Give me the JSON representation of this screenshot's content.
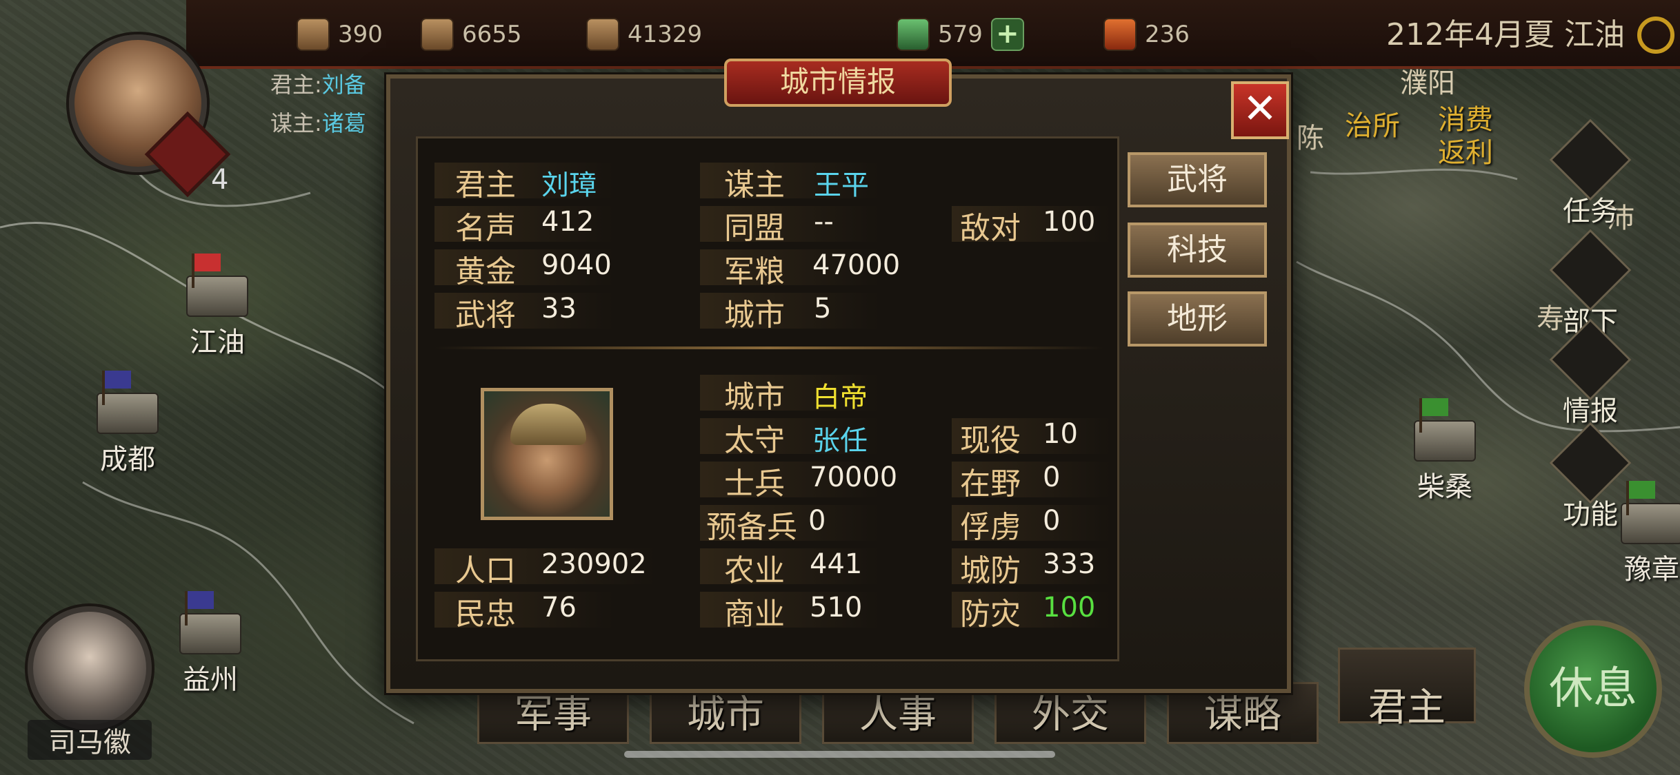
{
  "top_bar": {
    "resources": [
      {
        "icon": "ore-icon",
        "value": "390"
      },
      {
        "icon": "coin-pouch-icon",
        "value": "6655"
      },
      {
        "icon": "grain-icon",
        "value": "41329"
      },
      {
        "icon": "jade-icon",
        "value": "579"
      },
      {
        "icon": "scroll-icon",
        "value": "236"
      }
    ],
    "datetime_location": "212年4月夏 江油"
  },
  "ruler_info": {
    "ruler_label": "君主:",
    "ruler_value": "刘备",
    "advisor_label": "谋主:",
    "advisor_value": "诸葛",
    "seal_count": "4"
  },
  "advisor_name": "司马徽",
  "map_cities": [
    {
      "name": "江油",
      "flag_color": "#c83030"
    },
    {
      "name": "成都",
      "flag_color": "#3a3a90"
    },
    {
      "name": "益州",
      "flag_color": "#3a3a90"
    },
    {
      "name": "柴桑",
      "flag_color": "#3a9030"
    },
    {
      "name": "豫章",
      "flag_color": "#3a9030"
    }
  ],
  "map_glyphs": [
    "濮阳",
    "陈",
    "沛",
    "寿"
  ],
  "right_menu": {
    "events": [
      {
        "label": "治所"
      },
      {
        "label": "消费返利"
      }
    ],
    "items": [
      {
        "label": "任务"
      },
      {
        "label": "部下"
      },
      {
        "label": "情报"
      },
      {
        "label": "功能"
      }
    ]
  },
  "bottom_menu": [
    "军事",
    "城市",
    "人事",
    "外交",
    "谋略",
    "君主"
  ],
  "rest_button": "休息",
  "dialog": {
    "title": "城市情报",
    "close_symbol": "✕",
    "side_buttons": [
      "武将",
      "科技",
      "地形"
    ],
    "faction": {
      "lord_label": "君主",
      "lord": "刘璋",
      "strategist_label": "谋主",
      "strategist": "王平",
      "fame_label": "名声",
      "fame": "412",
      "alliance_label": "同盟",
      "alliance": "--",
      "hostile_label": "敌对",
      "hostile": "100",
      "gold_label": "黄金",
      "gold": "9040",
      "food_label": "军粮",
      "food": "47000",
      "generals_label": "武将",
      "generals": "33",
      "cities_label": "城市",
      "cities": "5"
    },
    "city": {
      "city_label": "城市",
      "city": "白帝",
      "governor_label": "太守",
      "governor": "张任",
      "active_label": "现役",
      "active": "10",
      "soldiers_label": "士兵",
      "soldiers": "70000",
      "wild_label": "在野",
      "wild": "0",
      "reserves_label": "预备兵",
      "reserves": "0",
      "captives_label": "俘虏",
      "captives": "0",
      "population_label": "人口",
      "population": "230902",
      "agriculture_label": "农业",
      "agriculture": "441",
      "defense_label": "城防",
      "defense": "333",
      "loyalty_label": "民忠",
      "loyalty": "76",
      "commerce_label": "商业",
      "commerce": "510",
      "disaster_label": "防灾",
      "disaster": "100"
    }
  },
  "colors": {
    "label_gold": "#e8c890",
    "value_cyan": "#5ad4ec",
    "value_yellow": "#f0e030",
    "value_green": "#58e040",
    "title_red": "#a82c20"
  }
}
